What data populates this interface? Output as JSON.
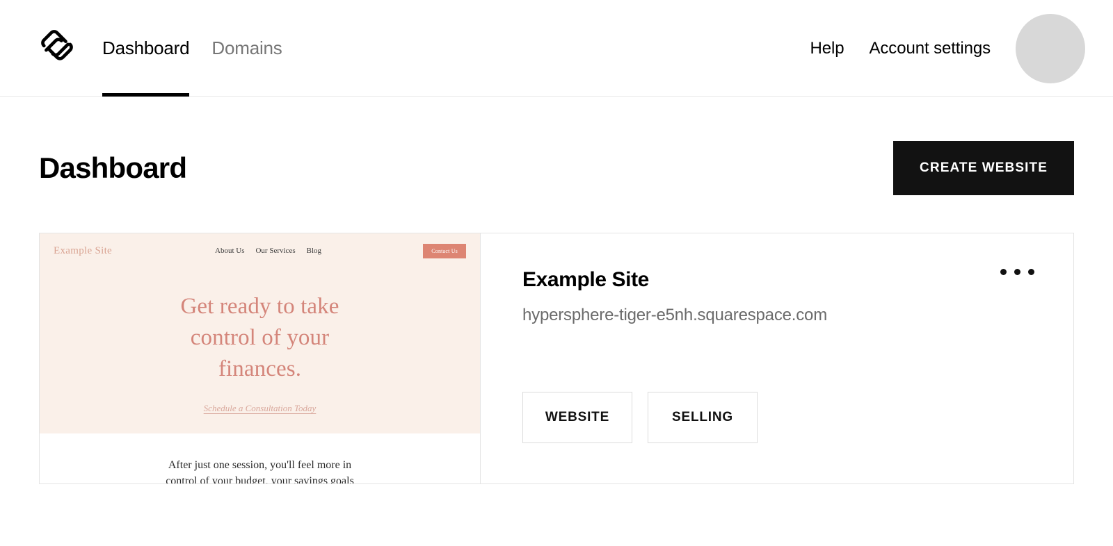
{
  "header": {
    "logo_icon": "squarespace-logo-icon",
    "tabs": [
      {
        "label": "Dashboard",
        "active": true
      },
      {
        "label": "Domains",
        "active": false
      }
    ],
    "links": [
      {
        "label": "Help"
      },
      {
        "label": "Account settings"
      }
    ],
    "avatar": {
      "name": "account-avatar",
      "color": "#d8d8d8"
    }
  },
  "page": {
    "title": "Dashboard",
    "create_button": "CREATE WEBSITE"
  },
  "site_card": {
    "thumbnail": {
      "brand": "Example Site",
      "nav": [
        "About Us",
        "Our Services",
        "Blog"
      ],
      "cta": "Contact Us",
      "headline": "Get ready to take control of your finances.",
      "headline_lines": [
        "Get ready to take",
        "control of your",
        "finances."
      ],
      "link": "Schedule a Consultation Today",
      "body_lines": [
        "After just one session, you'll feel more in",
        "control of your budget, your savings goals"
      ],
      "hero_bg": "#faf0e9",
      "accent": "#dd8573",
      "heading_color": "#d4857a"
    },
    "name": "Example Site",
    "domain": "hypersphere-tiger-e5nh.squarespace.com",
    "menu_icon": "kebab-menu-icon",
    "actions": [
      {
        "label": "WEBSITE"
      },
      {
        "label": "SELLING"
      }
    ]
  }
}
